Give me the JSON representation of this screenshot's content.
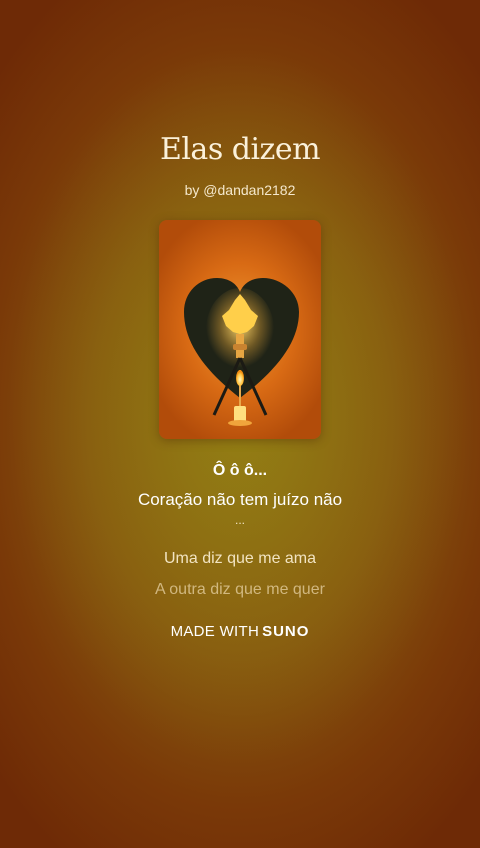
{
  "song": {
    "title": "Elas dizem",
    "byline": "by @dandan2182"
  },
  "cover_art": {
    "icon": "heart-candle-artwork-icon"
  },
  "lyrics": {
    "line_bold": "Ô ô ô...",
    "line_current": "Coração não tem juízo não",
    "line_dots": "...",
    "line_next": "Uma diz que me ama",
    "line_faded": "A outra diz que me quer"
  },
  "footer": {
    "made_with": "MADE WITH",
    "brand": "SUNO"
  },
  "colors": {
    "background_center": "#8f7414",
    "background_edge": "#6e2a06",
    "text_primary": "#ffffff"
  }
}
